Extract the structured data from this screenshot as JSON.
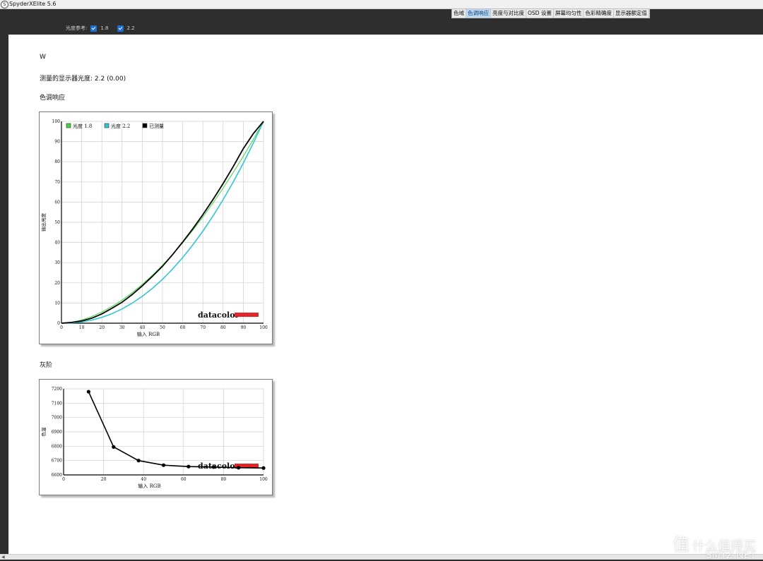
{
  "window": {
    "title": "SpyderXElite 5.6",
    "icon": "spyder-logo-icon"
  },
  "tabs": [
    {
      "label": "色域",
      "active": false
    },
    {
      "label": "色调响应",
      "active": true
    },
    {
      "label": "亮度与对比度",
      "active": false
    },
    {
      "label": "OSD 设置",
      "active": false
    },
    {
      "label": "屏幕均匀性",
      "active": false
    },
    {
      "label": "色彩精确度",
      "active": false
    },
    {
      "label": "显示器额定值",
      "active": false
    }
  ],
  "gamma_reference": {
    "label": "光度参考:",
    "options": [
      {
        "label": "1.8",
        "checked": true
      },
      {
        "label": "2.2",
        "checked": true
      }
    ]
  },
  "report": {
    "channel": "W",
    "measured_gamma": "测量的显示器光度:  2.2 (0.00)",
    "section_tone": "色调响应",
    "section_gray": "灰阶"
  },
  "chart_data": [
    {
      "type": "line",
      "xlabel": "输入 RGB",
      "ylabel": "输出亮度",
      "xlim": [
        0,
        100
      ],
      "ylim": [
        0,
        100
      ],
      "xticks": [
        0,
        10,
        20,
        30,
        40,
        50,
        60,
        70,
        80,
        90,
        100
      ],
      "yticks": [
        0,
        10,
        20,
        30,
        40,
        50,
        60,
        70,
        80,
        90,
        100
      ],
      "grid": true,
      "legend_position": "top-left",
      "watermark": "datacolor",
      "series": [
        {
          "name": "光度 1.8",
          "color": "#3cd63c",
          "gamma": 1.8,
          "x": [
            0,
            5,
            10,
            15,
            20,
            25,
            30,
            35,
            40,
            45,
            50,
            55,
            60,
            65,
            70,
            75,
            80,
            85,
            90,
            95,
            100
          ]
        },
        {
          "name": "光度 2.2",
          "color": "#33c6cf",
          "gamma": 2.2,
          "x": [
            0,
            5,
            10,
            15,
            20,
            25,
            30,
            35,
            40,
            45,
            50,
            55,
            60,
            65,
            70,
            75,
            80,
            85,
            90,
            95,
            100
          ]
        },
        {
          "name": "已测量",
          "color": "#000000",
          "x": [
            0,
            5,
            10,
            15,
            20,
            25,
            30,
            35,
            40,
            45,
            50,
            55,
            60,
            65,
            70,
            75,
            80,
            85,
            90,
            95,
            100
          ],
          "y": [
            0,
            0.4,
            1.1,
            2.5,
            4.6,
            7.4,
            10.4,
            14.2,
            18.5,
            23.2,
            28.2,
            34.0,
            40.2,
            46.8,
            53.8,
            61.3,
            69.2,
            77.6,
            86.5,
            94.0,
            100
          ]
        }
      ]
    },
    {
      "type": "line",
      "xlabel": "输入 RGB",
      "ylabel": "色温",
      "xlim": [
        0,
        100
      ],
      "ylim": [
        6600,
        7200
      ],
      "xticks": [
        0,
        20,
        40,
        60,
        80,
        100
      ],
      "yticks": [
        6600,
        6700,
        6800,
        6900,
        7000,
        7100,
        7200
      ],
      "grid": true,
      "watermark": "datacolor",
      "series": [
        {
          "name": "",
          "color": "#000000",
          "x": [
            12.5,
            25,
            37.5,
            50,
            62.5,
            75,
            87.5,
            100
          ],
          "y": [
            7180,
            6795,
            6700,
            6668,
            6658,
            6655,
            6650,
            6648
          ]
        }
      ]
    }
  ],
  "watermark": {
    "text": "什么值得买",
    "sub": "SMYZ.NET"
  }
}
